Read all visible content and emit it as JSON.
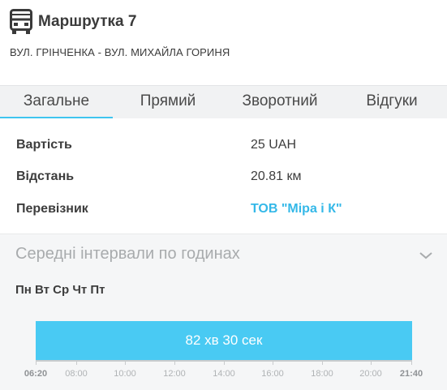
{
  "header": {
    "title": "Маршрутка 7",
    "route": "ВУЛ. ГРІНЧЕНКА - ВУЛ. МИХАЙЛА ГОРИНЯ",
    "icon": "bus-icon"
  },
  "tabs": [
    {
      "label": "Загальне",
      "active": true
    },
    {
      "label": "Прямий",
      "active": false
    },
    {
      "label": "Зворотний",
      "active": false
    },
    {
      "label": "Відгуки",
      "active": false
    }
  ],
  "info": {
    "price_label": "Вартість",
    "price_value": "25 UAH",
    "distance_label": "Відстань",
    "distance_value": "20.81 км",
    "carrier_label": "Перевізник",
    "carrier_value": "ТОВ \"Міра і К\""
  },
  "intervals": {
    "title": "Середні інтервали по годинах",
    "days": "Пн Вт Ср Чт Пт",
    "bar_label": "82 хв 30 сек",
    "start_time": "06:20",
    "end_time": "21:40",
    "ticks": [
      "08:00",
      "10:00",
      "12:00",
      "14:00",
      "16:00",
      "18:00",
      "20:00"
    ]
  },
  "colors": {
    "accent": "#3fc4ef",
    "bar": "#49caf3",
    "link": "#34b8e8"
  }
}
